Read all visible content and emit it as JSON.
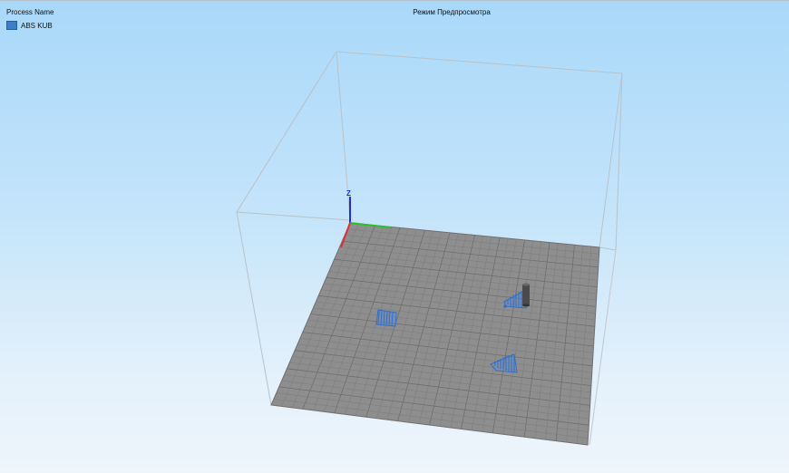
{
  "legend": {
    "header": "Process Name",
    "items": [
      {
        "label": "ABS KUB",
        "color": "#3b7fc9"
      }
    ]
  },
  "view": {
    "title": "Режим Предпросмотра"
  },
  "axes": {
    "z_label": "Z"
  },
  "colors": {
    "bed": "#8e8e8e",
    "grid_line": "#7a7a7a",
    "toolpath": "#2f6fd0",
    "build_volume": "#b9c2c9",
    "axis_x": "#e03030",
    "axis_y": "#27c227",
    "axis_z": "#1c2fe0"
  },
  "icons": {
    "legend_swatch": "color-swatch",
    "nozzle": "nozzle-icon"
  }
}
